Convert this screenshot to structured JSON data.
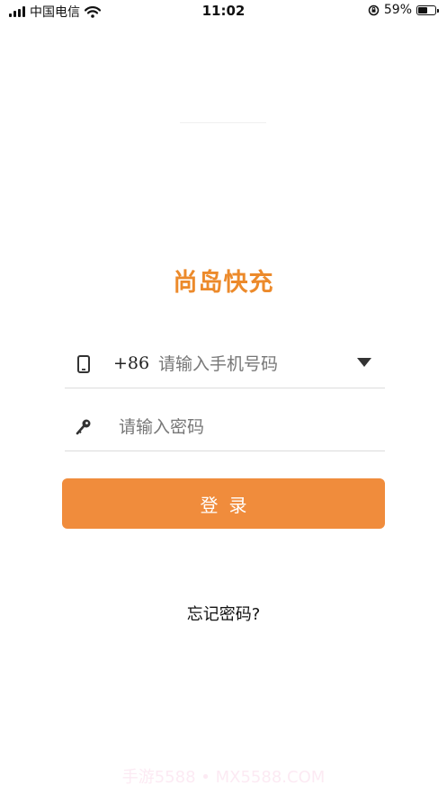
{
  "status_bar": {
    "carrier": "中国电信",
    "time": "11:02",
    "battery": "59%",
    "battery_level": 0.59,
    "icons": [
      "signal-icon",
      "wifi-icon",
      "rotation-lock-icon",
      "battery-icon"
    ]
  },
  "app": {
    "logo_text": "尚岛快充",
    "brand_color": "#ec8a2b"
  },
  "form": {
    "country_code": "+86",
    "phone_placeholder": "请输入手机号码",
    "phone_value": "",
    "password_placeholder": "请输入密码",
    "password_value": "",
    "login_label": "登录",
    "forgot_label": "忘记密码?",
    "button_color": "#f08c3c"
  },
  "watermark": "手游5588 • MX5588.COM"
}
